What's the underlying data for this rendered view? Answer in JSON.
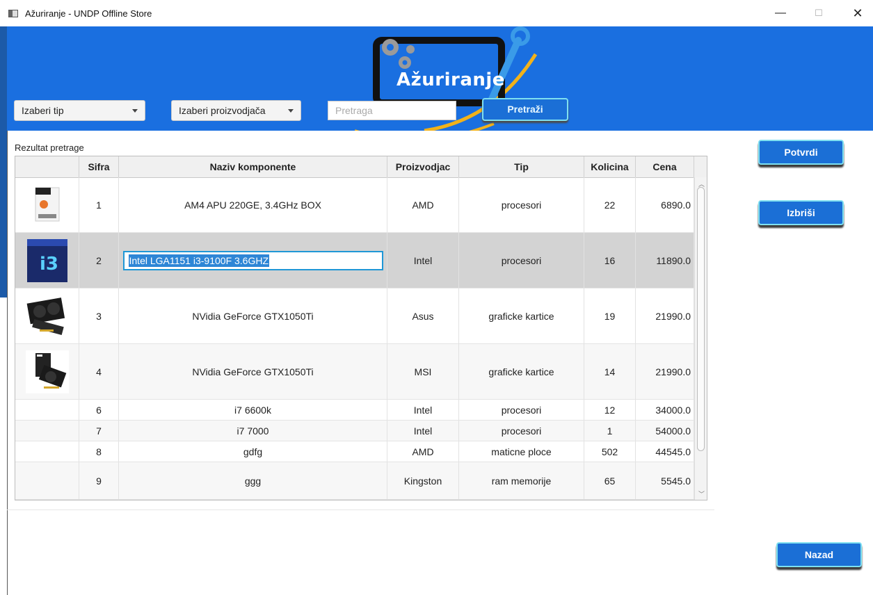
{
  "window": {
    "title": "Ažuriranje - UNDP Offline Store",
    "minimize": "—",
    "maximize": "☐",
    "close": "✕"
  },
  "header": {
    "heading": "Ažuriranje",
    "type_select": "Izaberi tip",
    "manufacturer_select": "Izaberi proizvodjača",
    "search_placeholder": "Pretraga",
    "search_button": "Pretraži"
  },
  "result_label": "Rezultat pretrage",
  "table": {
    "columns": [
      "",
      "Sifra",
      "Naziv komponente",
      "Proizvodjac",
      "Tip",
      "Kolicina",
      "Cena"
    ],
    "rows": [
      {
        "image": "amd-cpu-box",
        "sifra": "1",
        "naziv": "AM4 APU 220GE, 3.4GHz BOX",
        "proizvodjac": "AMD",
        "tip": "procesori",
        "kolicina": "22",
        "cena": "6890.0"
      },
      {
        "image": "intel-i3-box",
        "sifra": "2",
        "naziv": "Intel LGA1151 i3-9100F 3.6GHZ",
        "proizvodjac": "Intel",
        "tip": "procesori",
        "kolicina": "16",
        "cena": "11890.0"
      },
      {
        "image": "asus-gpu",
        "sifra": "3",
        "naziv": "NVidia GeForce GTX1050Ti",
        "proizvodjac": "Asus",
        "tip": "graficke kartice",
        "kolicina": "19",
        "cena": "21990.0"
      },
      {
        "image": "msi-gpu",
        "sifra": "4",
        "naziv": "NVidia GeForce GTX1050Ti",
        "proizvodjac": "MSI",
        "tip": "graficke kartice",
        "kolicina": "14",
        "cena": "21990.0"
      },
      {
        "image": "",
        "sifra": "6",
        "naziv": "i7 6600k",
        "proizvodjac": "Intel",
        "tip": "procesori",
        "kolicina": "12",
        "cena": "34000.0"
      },
      {
        "image": "",
        "sifra": "7",
        "naziv": "i7 7000",
        "proizvodjac": "Intel",
        "tip": "procesori",
        "kolicina": "1",
        "cena": "54000.0"
      },
      {
        "image": "",
        "sifra": "8",
        "naziv": "gdfg",
        "proizvodjac": "AMD",
        "tip": "maticne ploce",
        "kolicina": "502",
        "cena": "44545.0"
      },
      {
        "image": "",
        "sifra": "9",
        "naziv": "ggg",
        "proizvodjac": "Kingston",
        "tip": "ram memorije",
        "kolicina": "65",
        "cena": "5545.0"
      }
    ]
  },
  "buttons": {
    "confirm": "Potvrdi",
    "delete": "Izbriši",
    "back": "Nazad"
  },
  "colors": {
    "header_blue": "#1a6fe0",
    "button_blue": "#1b6fd6",
    "button_border": "#7fe0f0",
    "selection_row": "#d3d3d3"
  }
}
